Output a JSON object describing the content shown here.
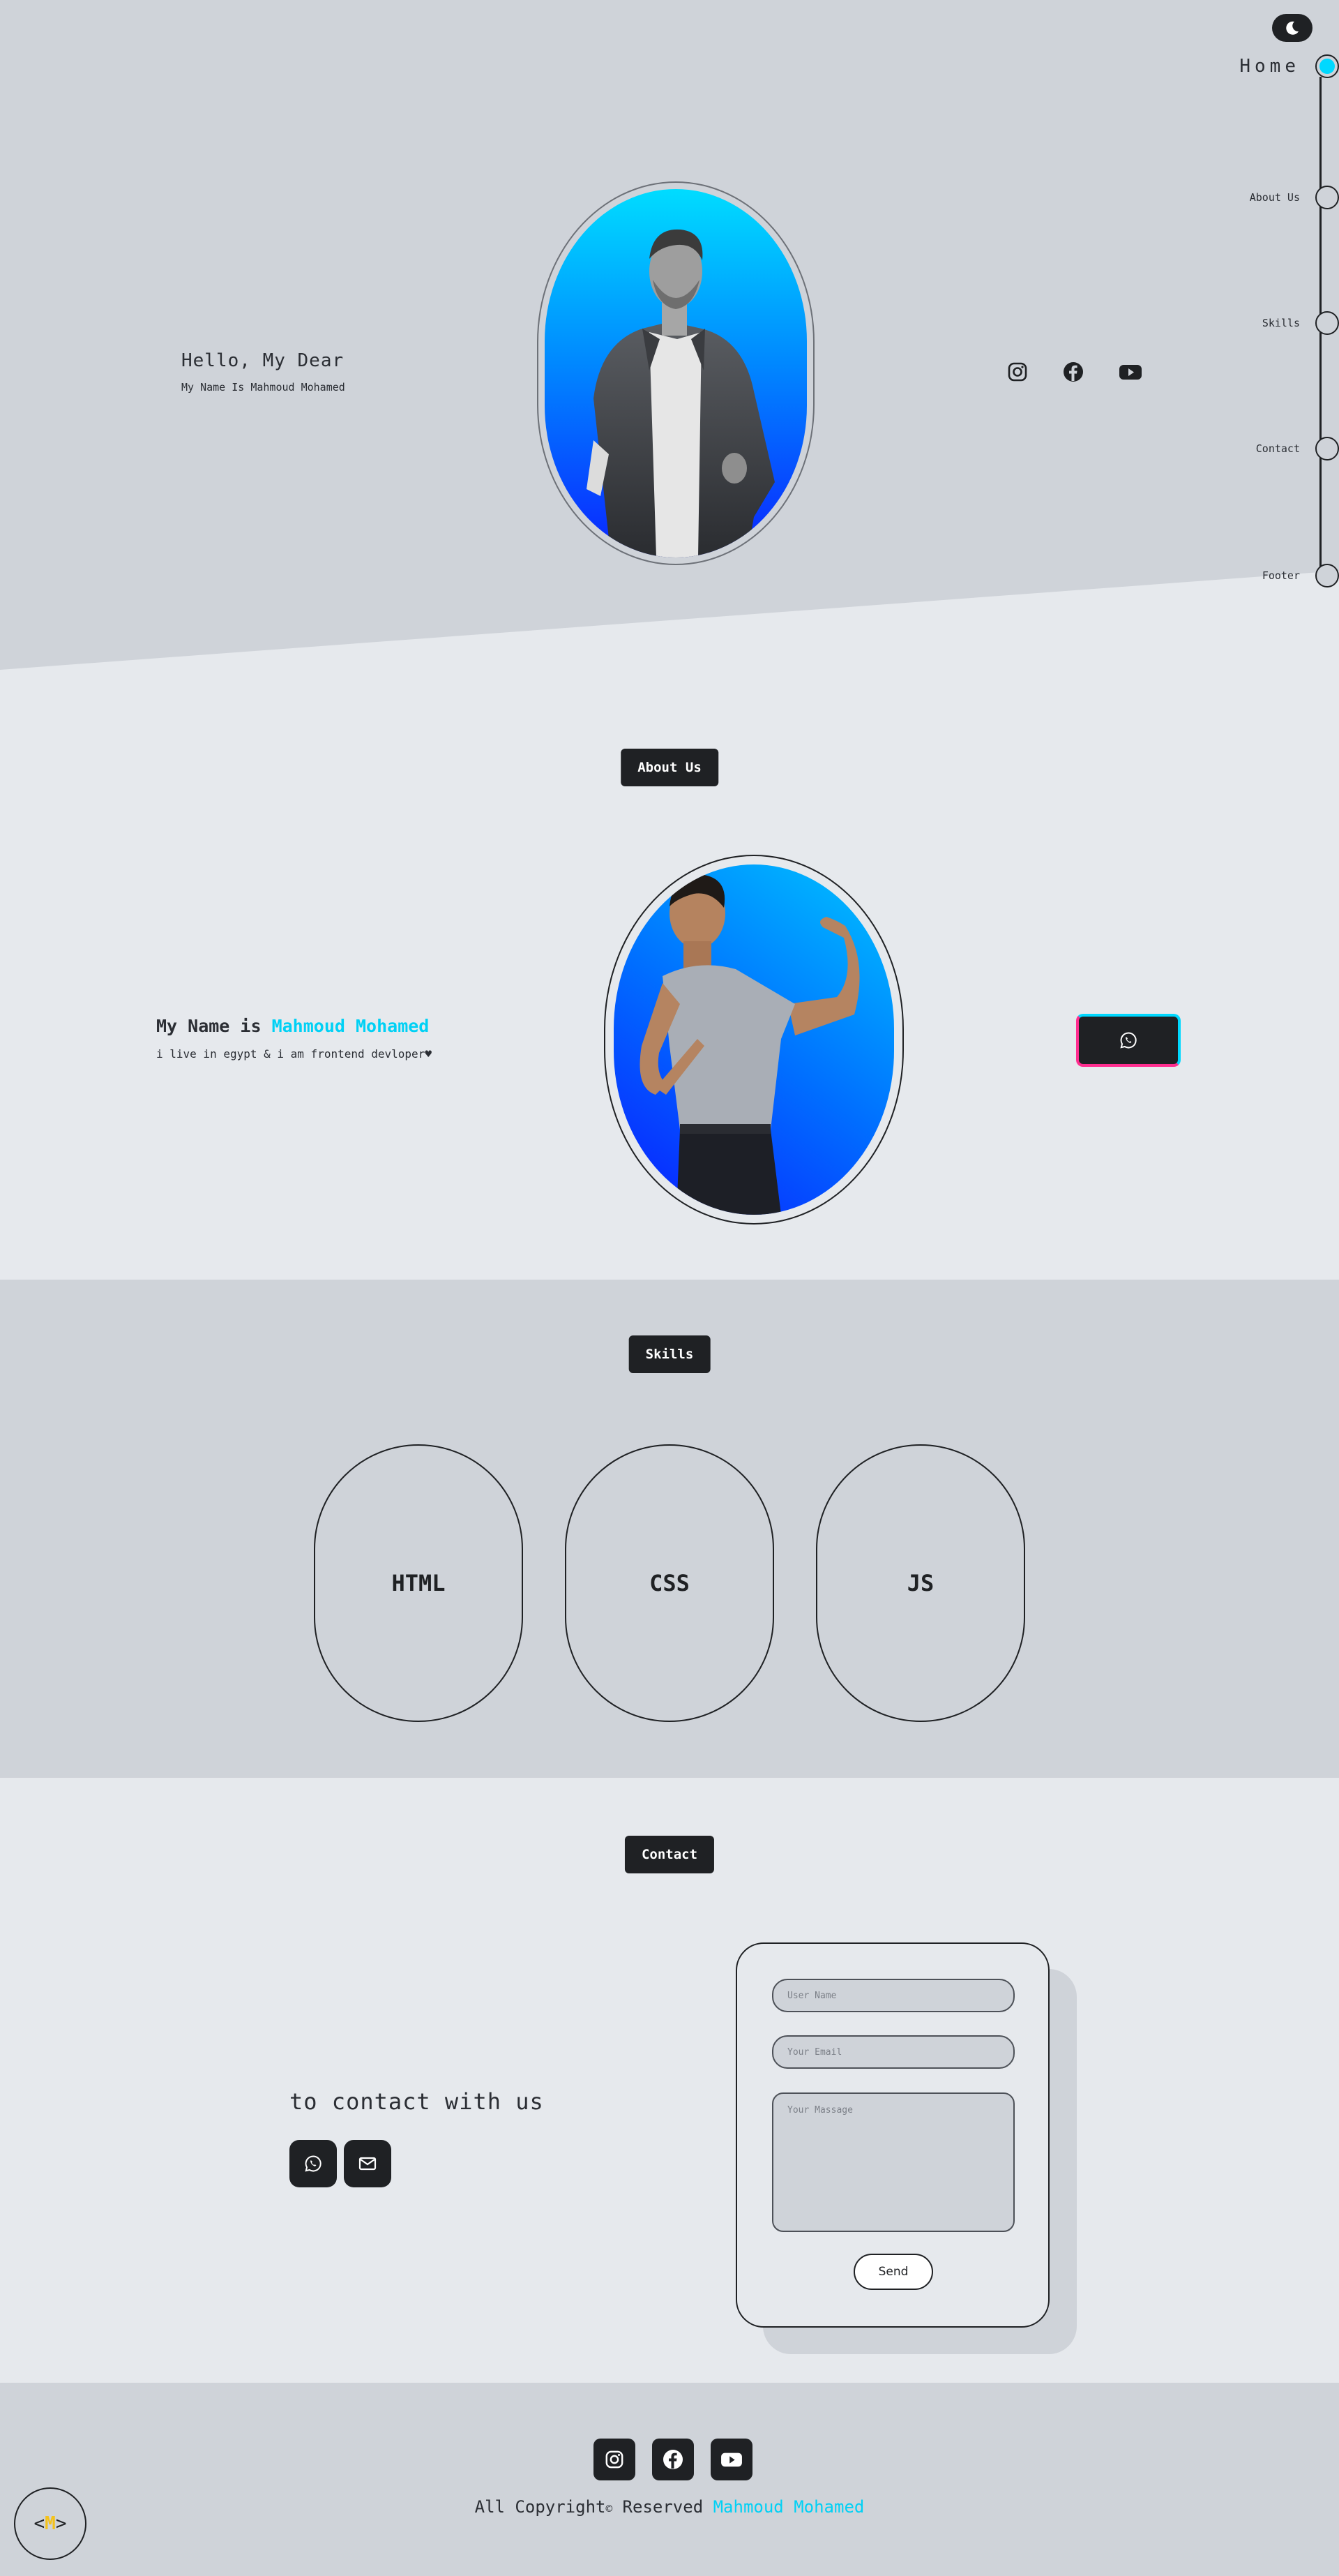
{
  "theme_toggle": {
    "icon": "moon-icon"
  },
  "nav": {
    "items": [
      {
        "label": "Home",
        "active": true
      },
      {
        "label": "About Us",
        "active": false
      },
      {
        "label": "Skills",
        "active": false
      },
      {
        "label": "Contact",
        "active": false
      },
      {
        "label": "Footer",
        "active": false
      }
    ]
  },
  "hero": {
    "greeting": "Hello, My Dear",
    "subtitle": "My Name Is Mahmoud Mohamed",
    "social": [
      "instagram-icon",
      "facebook-icon",
      "youtube-icon"
    ]
  },
  "about": {
    "title": "About Us",
    "heading_prefix": "My Name is ",
    "heading_name": "Mahmoud Mohamed",
    "description": "i live in egypt & i am frontend devloper♥"
  },
  "skills": {
    "title": "Skills",
    "items": [
      "HTML",
      "CSS",
      "JS"
    ]
  },
  "contact": {
    "title": "Contact",
    "heading": "to contact with us",
    "form": {
      "name_placeholder": "User Name",
      "email_placeholder": "Your Email",
      "message_placeholder": "Your Massage",
      "send_label": "Send"
    }
  },
  "footer": {
    "copyright_prefix": "All Copyright",
    "copyright_symbol": "©",
    "copyright_middle": " Reserved ",
    "copyright_name": "Mahmoud Mohamed",
    "logo_left": "<",
    "logo_letter": "M",
    "logo_right": ">"
  },
  "colors": {
    "accent": "#00d8ff",
    "dark": "#1f2124",
    "panel": "#cfd3d9",
    "background": "#e6e9ed",
    "logo_yellow": "#f4c21b",
    "pink": "#ff2d8f"
  }
}
